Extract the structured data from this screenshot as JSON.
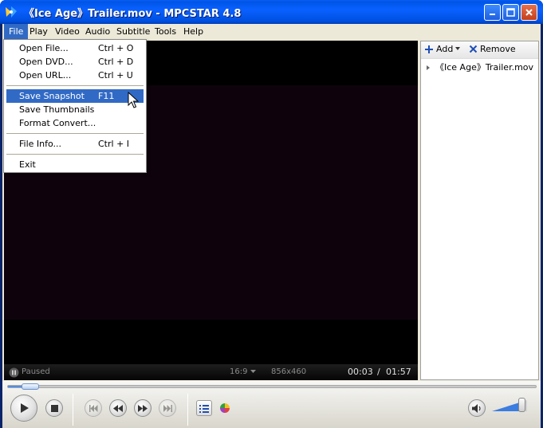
{
  "window": {
    "title": "《Ice Age》Trailer.mov - MPCSTAR 4.8"
  },
  "menubar": {
    "items": [
      {
        "label": "File"
      },
      {
        "label": "Play"
      },
      {
        "label": "Video"
      },
      {
        "label": "Audio"
      },
      {
        "label": "Subtitle"
      },
      {
        "label": "Tools"
      },
      {
        "label": "Help"
      }
    ]
  },
  "file_menu": {
    "items": [
      {
        "label": "Open File...",
        "shortcut": "Ctrl + O"
      },
      {
        "label": "Open DVD...",
        "shortcut": "Ctrl + D"
      },
      {
        "label": "Open URL...",
        "shortcut": "Ctrl + U"
      },
      {
        "label": "Save Snapshot",
        "shortcut": "F11"
      },
      {
        "label": "Save Thumbnails",
        "shortcut": ""
      },
      {
        "label": "Format Convert...",
        "shortcut": ""
      },
      {
        "label": "File Info...",
        "shortcut": "Ctrl + I"
      },
      {
        "label": "Exit",
        "shortcut": ""
      }
    ],
    "highlighted": "Save Snapshot"
  },
  "playlist": {
    "add_label": "Add",
    "remove_label": "Remove",
    "items": [
      {
        "label": "《Ice Age》Trailer.mov"
      }
    ]
  },
  "status": {
    "state": "Paused",
    "aspect": "16:9",
    "resolution": "856x460",
    "current_time": "00:03",
    "separator": "/",
    "total_time": "01:57"
  },
  "playback": {
    "progress_fraction": 0.026,
    "volume_fraction": 0.85
  },
  "icons": {
    "app": "mpcstar-logo-icon",
    "minimize": "minimize-icon",
    "maximize": "maximize-icon",
    "close": "close-icon",
    "add": "plus-icon",
    "remove": "x-icon",
    "paused": "pause-icon",
    "play": "play-icon",
    "stop": "stop-icon",
    "prev": "skip-back-icon",
    "rewind": "rewind-icon",
    "forward": "fast-forward-icon",
    "next": "skip-forward-icon",
    "playlist": "list-icon",
    "color": "color-wheel-icon",
    "volume": "speaker-icon"
  },
  "colors": {
    "titlebar": "#0a61ff",
    "menu_highlight": "#316ac5",
    "video_bg": "#000000"
  }
}
